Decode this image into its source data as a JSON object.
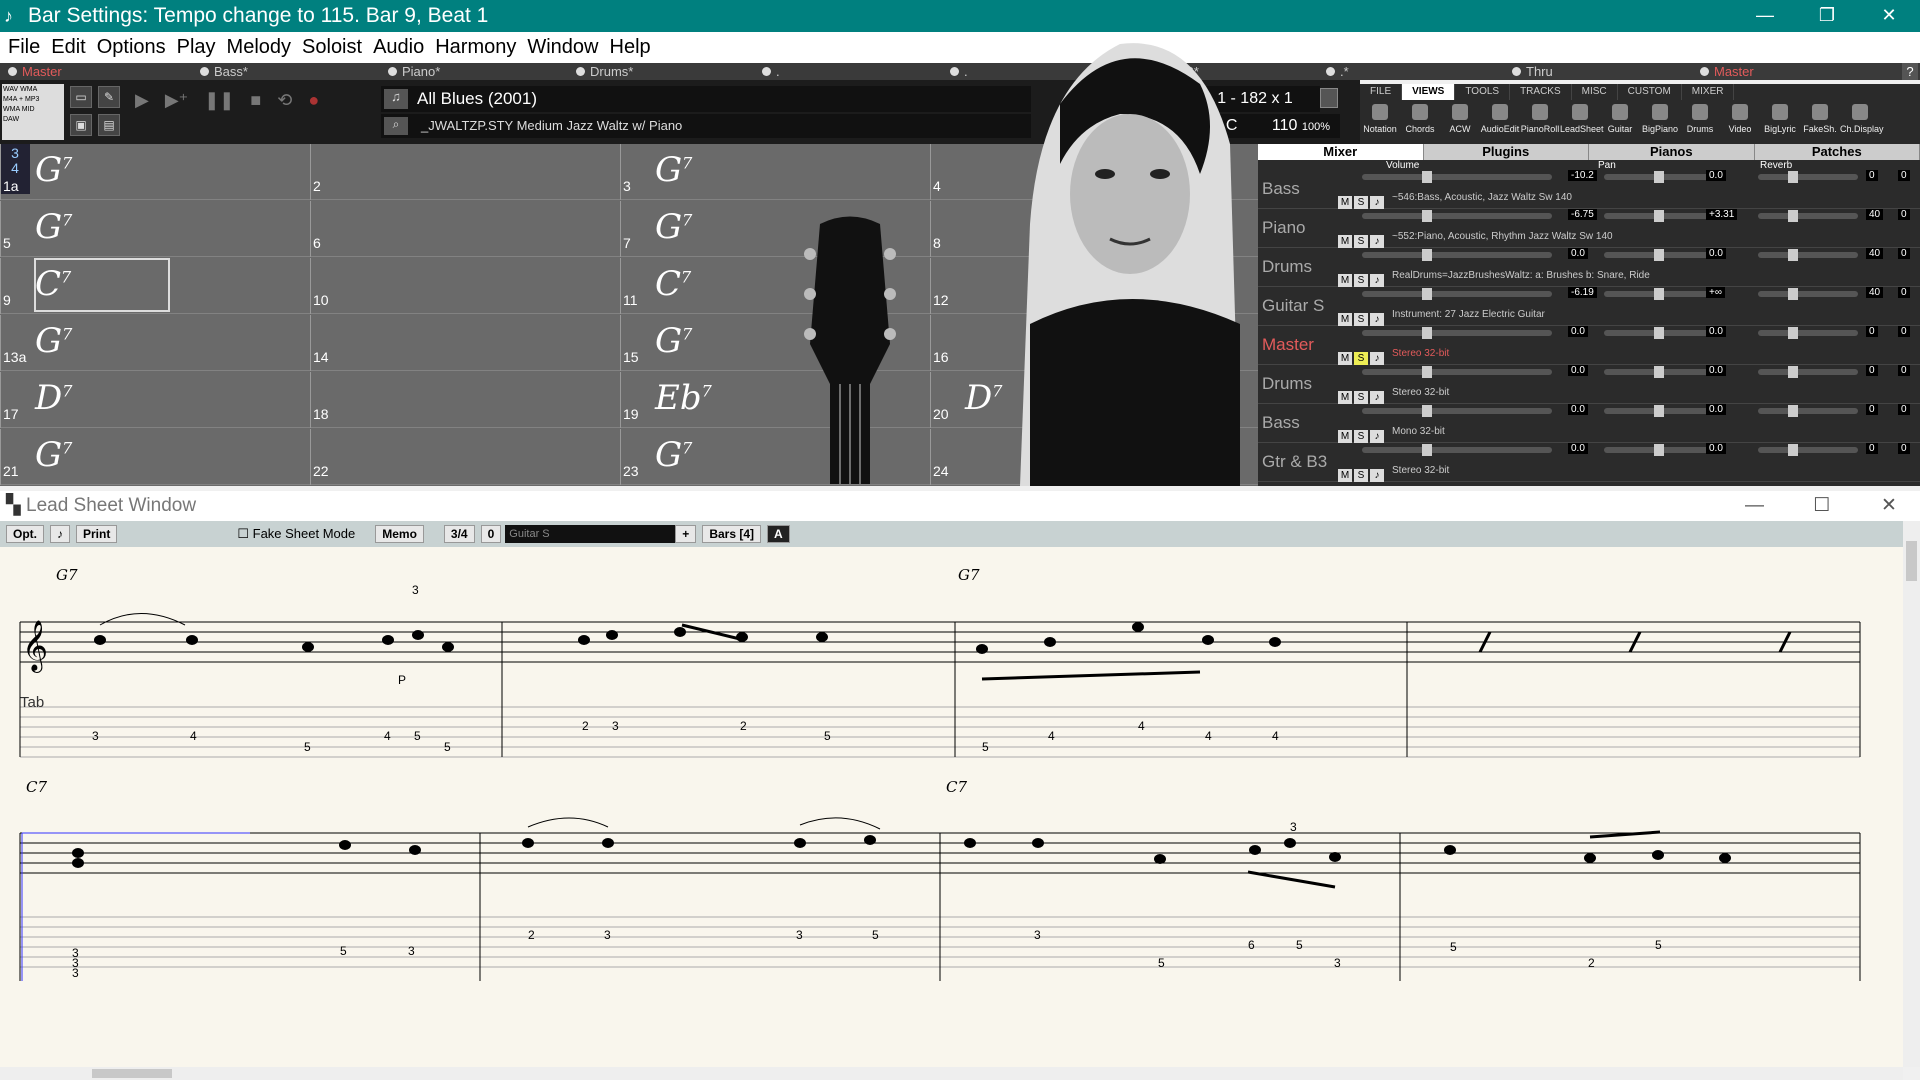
{
  "titlebar": {
    "title": "Bar Settings: Tempo change to 115.   Bar 9, Beat 1",
    "min": "—",
    "restore": "❐",
    "close": "✕"
  },
  "menu": [
    "File",
    "Edit",
    "Options",
    "Play",
    "Melody",
    "Soloist",
    "Audio",
    "Harmony",
    "Window",
    "Help"
  ],
  "tracks": [
    "Master",
    "Bass*",
    "Piano*",
    "Drums*",
    ".",
    ".",
    "ar S*",
    ".*",
    "Thru",
    "Master"
  ],
  "toolbar": {
    "song_title": "All Blues (2001)",
    "style": "_JWALTZP.STY Medium Jazz Waltz w/ Piano",
    "position": "1  - 182 x  1",
    "key": "C",
    "tempo": "110",
    "zoom": "100%",
    "time_sig": "4"
  },
  "left_icons": [
    "WAV",
    "WMA",
    "M4A",
    "MP3",
    "WMA",
    "MID",
    "DAW"
  ],
  "view_tabs": [
    "FILE",
    "VIEWS",
    "TOOLS",
    "TRACKS",
    "MISC",
    "CUSTOM",
    "MIXER"
  ],
  "view_icons": [
    "Notation",
    "Chords",
    "ACW",
    "AudioEdit",
    "PianoRoll",
    "LeadSheet",
    "Guitar",
    "BigPiano",
    "Drums",
    "Video",
    "BigLyric",
    "FakeSh.",
    "Ch.Display"
  ],
  "chordsheet": {
    "time_top": "3",
    "time_bottom": "4",
    "rows": [
      [
        {
          "num": "1a",
          "chord": "G",
          "ext": "7"
        },
        {
          "num": "2",
          "chord": "",
          "ext": ""
        },
        {
          "num": "3",
          "chord": "G",
          "ext": "7"
        },
        {
          "num": "4",
          "chord": "",
          "ext": ""
        }
      ],
      [
        {
          "num": "5",
          "chord": "G",
          "ext": "7"
        },
        {
          "num": "6",
          "chord": "",
          "ext": ""
        },
        {
          "num": "7",
          "chord": "G",
          "ext": "7"
        },
        {
          "num": "8",
          "chord": "",
          "ext": ""
        }
      ],
      [
        {
          "num": "9",
          "chord": "C",
          "ext": "7"
        },
        {
          "num": "10",
          "chord": "",
          "ext": ""
        },
        {
          "num": "11",
          "chord": "C",
          "ext": "7"
        },
        {
          "num": "12",
          "chord": "",
          "ext": ""
        }
      ],
      [
        {
          "num": "13a",
          "chord": "G",
          "ext": "7"
        },
        {
          "num": "14",
          "chord": "",
          "ext": ""
        },
        {
          "num": "15",
          "chord": "G",
          "ext": "7"
        },
        {
          "num": "16",
          "chord": "",
          "ext": ""
        }
      ],
      [
        {
          "num": "17",
          "chord": "D",
          "ext": "7"
        },
        {
          "num": "18",
          "chord": "",
          "ext": ""
        },
        {
          "num": "19",
          "chord": "Eb",
          "ext": "7"
        },
        {
          "num": "20",
          "chord": "D",
          "ext": "7"
        }
      ],
      [
        {
          "num": "21",
          "chord": "G",
          "ext": "7"
        },
        {
          "num": "22",
          "chord": "",
          "ext": ""
        },
        {
          "num": "23",
          "chord": "G",
          "ext": "7"
        },
        {
          "num": "24",
          "chord": "",
          "ext": ""
        }
      ]
    ]
  },
  "mixer": {
    "tabs": [
      "Mixer",
      "Plugins",
      "Pianos",
      "Patches"
    ],
    "col_volume": "Volume",
    "col_pan": "Pan",
    "col_reverb": "Reverb",
    "rows": [
      {
        "name": "Bass",
        "vol": "-10.2",
        "pan": "0.0",
        "rev": "0",
        "x": "0",
        "inst": "~546:Bass, Acoustic, Jazz Waltz Sw 140"
      },
      {
        "name": "Piano",
        "vol": "-6.75",
        "pan": "+3.31",
        "rev": "40",
        "x": "0",
        "inst": "~552:Piano, Acoustic, Rhythm Jazz Waltz Sw 140"
      },
      {
        "name": "Drums",
        "vol": "0.0",
        "pan": "0.0",
        "rev": "40",
        "x": "0",
        "inst": "RealDrums=JazzBrushesWaltz: a: Brushes b: Snare, Ride"
      },
      {
        "name": "Guitar S",
        "vol": "-6.19",
        "pan": "+∞",
        "rev": "40",
        "x": "0",
        "inst": "Instrument: 27 Jazz Electric Guitar"
      },
      {
        "name": "Master",
        "vol": "0.0",
        "pan": "0.0",
        "rev": "0",
        "x": "0",
        "inst": "Stereo 32-bit"
      },
      {
        "name": "Drums",
        "vol": "0.0",
        "pan": "0.0",
        "rev": "0",
        "x": "0",
        "inst": "Stereo 32-bit"
      },
      {
        "name": "Bass",
        "vol": "0.0",
        "pan": "0.0",
        "rev": "0",
        "x": "0",
        "inst": "Mono 32-bit"
      },
      {
        "name": "Gtr & B3",
        "vol": "0.0",
        "pan": "0.0",
        "rev": "0",
        "x": "0",
        "inst": "Stereo 32-bit"
      }
    ]
  },
  "leadsheet": {
    "title": "Lead Sheet Window",
    "opt": "Opt.",
    "print": "Print",
    "fake_sheet": "Fake Sheet Mode",
    "memo": "Memo",
    "time_sig": "3/4",
    "zero": "0",
    "track": "Guitar S",
    "plus": "+",
    "bars": "Bars [4]",
    "chord_labels": [
      "G7",
      "G7",
      "C7",
      "C7"
    ],
    "tab_label": "Tab",
    "p_mark": "P",
    "triplet": "3",
    "tab_row1": [
      "3",
      "4",
      "5",
      "4",
      "5",
      "5",
      "2",
      "3",
      "2",
      "5",
      "5",
      "4",
      "4",
      "4",
      "4"
    ],
    "tab_row2": [
      "3",
      "3",
      "3",
      "5",
      "3",
      "2",
      "3",
      "3",
      "5",
      "3",
      "5",
      "6",
      "5",
      "3",
      "5",
      "2",
      "5"
    ]
  }
}
